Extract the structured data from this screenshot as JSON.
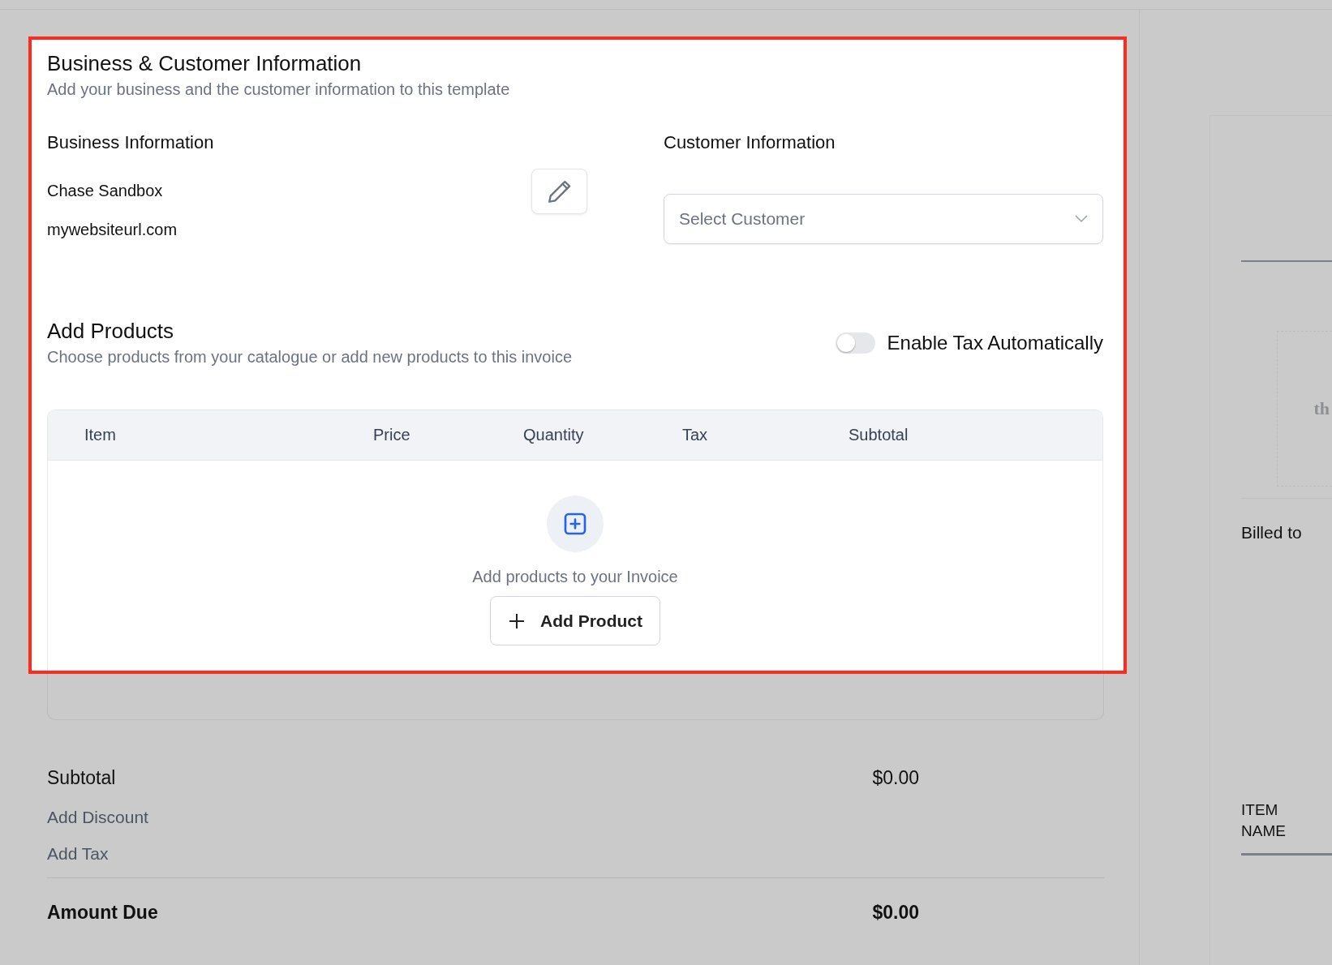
{
  "section": {
    "title": "Business & Customer Information",
    "subtitle": "Add your business and the customer information to this template"
  },
  "business": {
    "heading": "Business Information",
    "name": "Chase Sandbox",
    "website": "mywebsiteurl.com"
  },
  "customer": {
    "heading": "Customer Information",
    "select": {
      "placeholder": "Select Customer"
    }
  },
  "products": {
    "title": "Add Products",
    "description": "Choose products from your catalogue or add new products to this invoice",
    "tax_toggle": {
      "label": "Enable Tax Automatically",
      "on": false
    }
  },
  "table": {
    "columns": [
      "Item",
      "Price",
      "Quantity",
      "Tax",
      "Subtotal"
    ],
    "empty_text": "Add products to your Invoice",
    "add_button": "Add Product"
  },
  "totals": {
    "subtotal_label": "Subtotal",
    "subtotal_value": "$0.00",
    "discount_link": "Add Discount",
    "tax_link": "Add Tax",
    "amount_due_label": "Amount Due",
    "amount_due_value": "$0.00"
  },
  "preview": {
    "cut_text": "th",
    "billed_to": "Billed to",
    "item_header": "ITEM NAME"
  }
}
